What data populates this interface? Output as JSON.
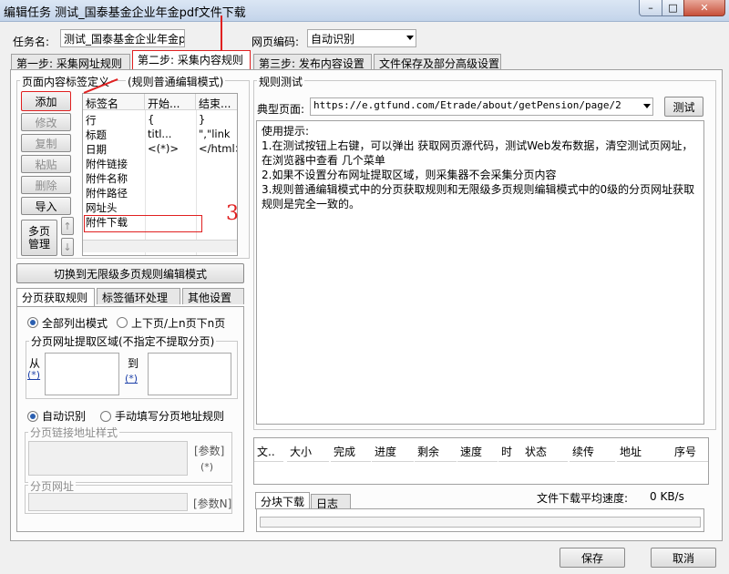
{
  "window": {
    "title": "编辑任务 测试_国泰基金企业年金pdf文件下载",
    "min_glyph": "–",
    "max_glyph": "□",
    "close_glyph": "✕"
  },
  "task_name": {
    "label": "任务名:",
    "value": "测试_国泰基金企业年金p"
  },
  "encoding": {
    "label": "网页编码:",
    "value": "自动识别"
  },
  "main_tabs": [
    {
      "label": "第一步: 采集网址规则"
    },
    {
      "label": "第二步: 采集内容规则"
    },
    {
      "label": "第三步: 发布内容设置"
    },
    {
      "label": "文件保存及部分高级设置"
    }
  ],
  "left": {
    "section_title": "页面内容标签定义",
    "mode_note": "(规则普通编辑模式)",
    "buttons": {
      "add": "添加",
      "edit": "修改",
      "copy": "复制",
      "paste": "粘贴",
      "delete": "删除",
      "import": "导入",
      "multi_page": "多页\n管理",
      "up": "↑",
      "down": "↓"
    },
    "grid": {
      "columns": [
        "标签名",
        "开始...",
        "结束..."
      ],
      "rows": [
        [
          "行",
          "{",
          "}"
        ],
        [
          "标题",
          "titl...",
          "\",\"link"
        ],
        [
          "日期",
          "<(*)>",
          "</html>"
        ],
        [
          "附件链接",
          "",
          ""
        ],
        [
          "附件名称",
          "",
          ""
        ],
        [
          "附件路径",
          "",
          ""
        ],
        [
          "网址头",
          "",
          ""
        ],
        [
          "附件下载",
          "",
          ""
        ]
      ]
    },
    "switch_button": "切换到无限级多页规则编辑模式",
    "sub_tabs": [
      "分页获取规则",
      "标签循环处理",
      "其他设置"
    ],
    "pagination": {
      "radio_all": "全部列出模式",
      "radio_prevnext": "上下页/上n页下n页",
      "extract_area_label": "分页网址提取区域(不指定不提取分页)",
      "from_label": "从",
      "to_label": "到",
      "star_link": "(*)",
      "radio_auto": "自动识别",
      "radio_manual": "手动填写分页地址规则",
      "link_pattern_label": "分页链接地址样式",
      "param_label": "[参数]",
      "star_plain": "(*)",
      "page_url_label": "分页网址",
      "param_n_label": "[参数N]"
    },
    "annotation_mark": "3"
  },
  "right": {
    "section_title": "规则测试",
    "typical_page_label": "典型页面:",
    "typical_page_url": "https://e.gtfund.com/Etrade/about/getPension/page/2",
    "test_button": "测试",
    "hints": [
      "使用提示:",
      "1.在测试按钮上右键，可以弹出 获取网页源代码，测试Web发布数据，清空测试页网址，在浏览器中查看 几个菜单",
      "2.如果不设置分布网址提取区域，则采集器不会采集分页内容",
      "3.规则普通编辑模式中的分页获取规则和无限级多页规则编辑模式中的0级的分页网址获取规则是完全一致的。"
    ],
    "download_columns": [
      "文..",
      "大小",
      "完成",
      "进度",
      "剩余",
      "速度",
      "时",
      "状态",
      "续传",
      "地址",
      "序号"
    ],
    "bottom_tabs": [
      "分块下载",
      "日志"
    ],
    "avg_speed_label": "文件下载平均速度:",
    "avg_speed_value": "0 KB/s"
  },
  "footer": {
    "save": "保存",
    "cancel": "取消"
  }
}
